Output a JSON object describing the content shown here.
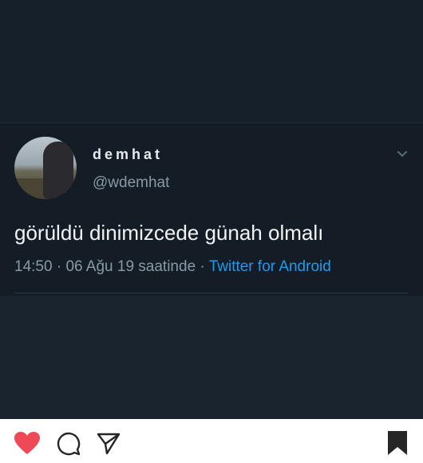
{
  "tweet": {
    "display_name": "demhat",
    "handle": "@wdemhat",
    "text": "görüldü dinimizcede günah olmalı",
    "time": "14:50",
    "separator1": " · ",
    "date_text": "06 Ağu 19 saatinde",
    "separator2": " · ",
    "source": "Twitter for Android"
  },
  "colors": {
    "background": "#141d26",
    "link": "#1d9bf0",
    "heart": "#ed4956"
  },
  "icons": {
    "menu": "chevron-down-icon",
    "like": "heart-icon",
    "comment": "comment-icon",
    "share": "send-icon",
    "save": "bookmark-icon"
  }
}
